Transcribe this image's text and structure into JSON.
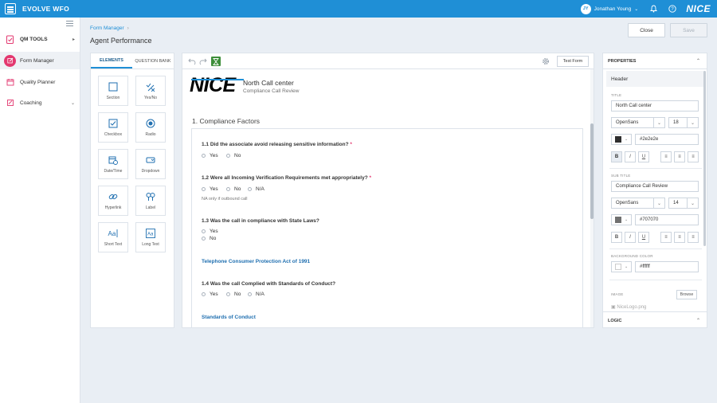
{
  "app": {
    "title": "EVOLVE WFO",
    "brand": "NICE",
    "colors": {
      "topbar": "#1f8fd6",
      "accent": "#e3376f",
      "link": "#1f6fb0"
    }
  },
  "user": {
    "initials": "JY",
    "name": "Jonathan Young"
  },
  "nav": {
    "qm_tools": "QM TOOLS",
    "items": [
      {
        "label": "Form Manager",
        "icon": "edit-form-icon"
      },
      {
        "label": "Quality Planner",
        "icon": "calendar-icon"
      },
      {
        "label": "Coaching",
        "icon": "coaching-icon"
      }
    ]
  },
  "header": {
    "breadcrumb": "Form Manager",
    "breadcrumb_sep": "›",
    "page_title": "Agent Performance",
    "close_label": "Close",
    "save_label": "Save"
  },
  "elements_panel": {
    "tabs": [
      "ELEMENTS",
      "QUESTION BANK"
    ],
    "tiles": [
      {
        "label": "Section",
        "icon": "section-icon"
      },
      {
        "label": "Yes/No",
        "icon": "yes-no-icon"
      },
      {
        "label": "Checkbox",
        "icon": "checkbox-icon"
      },
      {
        "label": "Radio",
        "icon": "radio-icon"
      },
      {
        "label": "Date/Time",
        "icon": "date-time-icon"
      },
      {
        "label": "Dropdown",
        "icon": "dropdown-icon"
      },
      {
        "label": "Hyperlink",
        "icon": "hyperlink-icon"
      },
      {
        "label": "Label",
        "icon": "label-icon"
      },
      {
        "label": "Short Text",
        "icon": "short-text-icon"
      },
      {
        "label": "Long Text",
        "icon": "long-text-icon"
      }
    ]
  },
  "canvas": {
    "test_form_label": "Test Form",
    "logo_text": "NICE",
    "form_title": "North Call center",
    "form_subtitle": "Compliance Call Review",
    "section_title": "1. Compliance Factors",
    "questions": [
      {
        "text": "1.1 Did the associate avoid releasing sensitive information?",
        "required": "*",
        "options": [
          "Yes",
          "No"
        ]
      },
      {
        "text": "1.2 Were all Incoming Verification Requirements met appropriately?",
        "required": "*",
        "options": [
          "Yes",
          "No",
          "N/A"
        ],
        "note": "NA only if outbound call"
      },
      {
        "text": "1.3 Was the call in compliance with State Laws?",
        "options": [
          "Yes",
          "No"
        ]
      },
      {
        "text": "1.4 Was the call Complied with Standards of Conduct?",
        "options": [
          "Yes",
          "No",
          "N/A"
        ]
      }
    ],
    "links": [
      "Telephone Consumer Protection Act of 1991",
      "Standards of Conduct"
    ]
  },
  "properties": {
    "heading": "PROPERTIES",
    "sub_heading": "Header",
    "title_label": "TITLE",
    "title_value": "North Call center",
    "title_font": "OpenSans",
    "title_size": "18",
    "title_color": "#2e2e2e",
    "subtitle_label": "SUB TITLE",
    "subtitle_value": "Compliance Call Review",
    "subtitle_font": "OpenSans",
    "subtitle_size": "14",
    "subtitle_color": "#707070",
    "bg_label": "BACKGROUND COLOR",
    "bg_color": "#ffffff",
    "image_label": "IMAGE",
    "browse_label": "Browse",
    "image_file": "NiceLogo.png",
    "format": {
      "bold": "B",
      "italic": "I",
      "underline": "U"
    },
    "logic_heading": "LOGIC"
  }
}
